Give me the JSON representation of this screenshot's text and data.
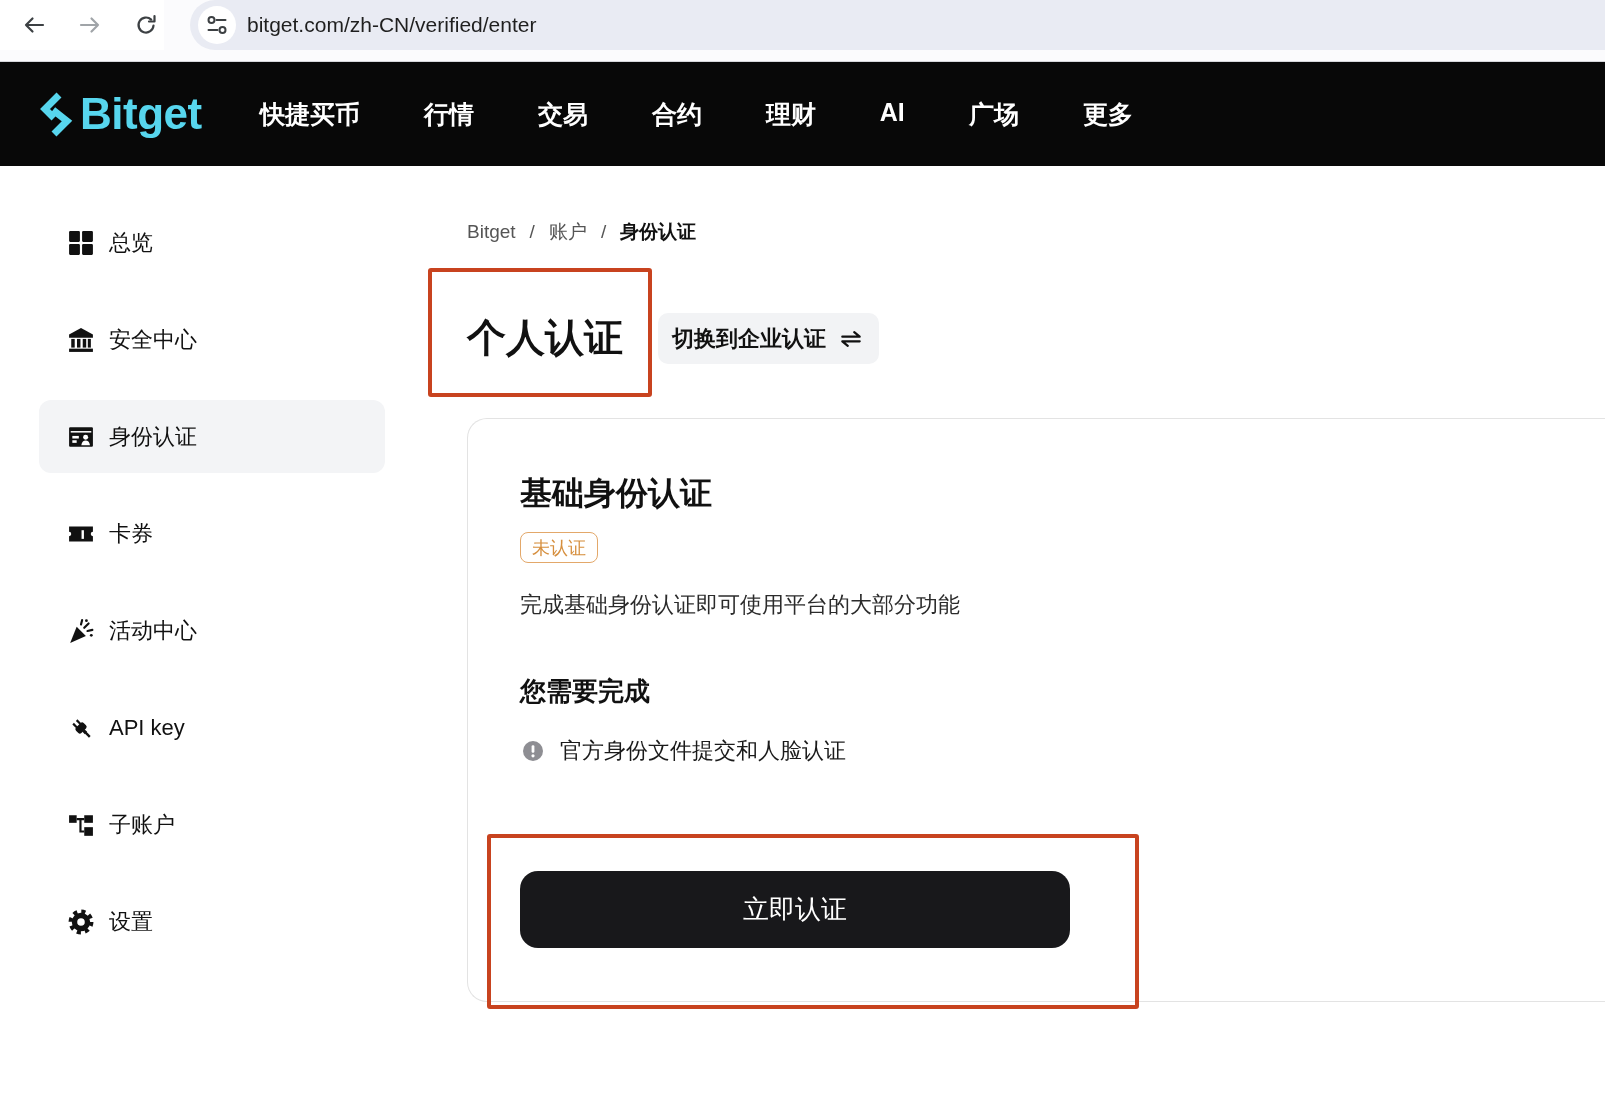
{
  "browser": {
    "url": "bitget.com/zh-CN/verified/enter",
    "forward_disabled": true
  },
  "nav": {
    "logo": "Bitget",
    "items": [
      "快捷买币",
      "行情",
      "交易",
      "合约",
      "理财",
      "AI",
      "广场",
      "更多"
    ]
  },
  "sidebar": {
    "items": [
      {
        "label": "总览",
        "selected": false
      },
      {
        "label": "安全中心",
        "selected": false
      },
      {
        "label": "身份认证",
        "selected": true
      },
      {
        "label": "卡券",
        "selected": false
      },
      {
        "label": "活动中心",
        "selected": false
      },
      {
        "label": "API key",
        "selected": false
      },
      {
        "label": "子账户",
        "selected": false
      },
      {
        "label": "设置",
        "selected": false
      }
    ]
  },
  "breadcrumb": [
    {
      "kind": "link",
      "label": "Bitget"
    },
    {
      "kind": "separator",
      "label": "/"
    },
    {
      "kind": "link",
      "label": "账户"
    },
    {
      "kind": "separator",
      "label": "/"
    },
    {
      "kind": "current",
      "label": "身份认证"
    }
  ],
  "page_title": {
    "text": "个人认证",
    "highlighted": true
  },
  "switch_button": {
    "label": "切换到企业认证"
  },
  "card": {
    "title": "基础身份认证",
    "badge": {
      "label": "未认证",
      "verified": false
    },
    "description": "完成基础身份认证即可使用平台的大部分功能",
    "requirements_title": "您需要完成",
    "requirements": [
      {
        "label": "官方身份文件提交和人脸认证",
        "done": false
      }
    ],
    "button": {
      "label": "立即认证",
      "highlighted": true
    }
  }
}
